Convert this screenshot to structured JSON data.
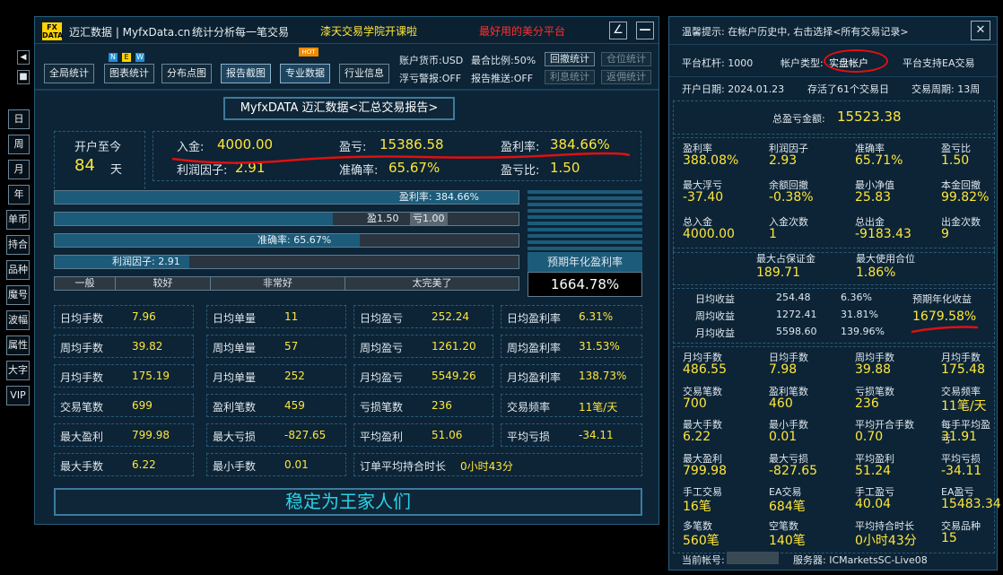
{
  "window": {
    "logo_top": "FX",
    "logo_bottom": "DATA",
    "title": "迈汇数据 | MyfxData.cn",
    "subtitle": "统计分析每一笔交易",
    "promo1": "漆天交易学院开课啦",
    "promo2": "最好用的美分平台",
    "pen_icon": "∠",
    "min_icon": "—"
  },
  "toolbar": {
    "buttons": [
      "全局统计",
      "图表统计",
      "分布点图",
      "报告截图",
      "专业数据",
      "行业信息"
    ],
    "new_badge": [
      "N",
      "E",
      "W"
    ],
    "hot_badge": "HOT",
    "currency": "账户货币:USD",
    "max_ratio": "最合比例:50%",
    "float_alert": "浮亏警报:OFF",
    "report_push": "报告推送:OFF",
    "small_buttons": [
      "回撤统计",
      "仓位统计",
      "利息统计",
      "返佣统计"
    ]
  },
  "left_nav": [
    "日",
    "周",
    "月",
    "年",
    "单币",
    "持合",
    "品种",
    "魔号",
    "波幅",
    "属性",
    "大字",
    "VIP"
  ],
  "report": {
    "title": "MyfxDATA 迈汇数据<汇总交易报告>",
    "since_label": "开户至今",
    "days": "84",
    "day_unit": "天",
    "deposit_label": "入金:",
    "deposit": "4000.00",
    "profit_label": "盈亏:",
    "profit": "15386.58",
    "return_label": "盈利率:",
    "return": "384.66%",
    "pf_label": "利润因子:",
    "pf": "2.91",
    "acc_label": "准确率:",
    "acc": "65.67%",
    "rr_label": "盈亏比:",
    "rr": "1.50"
  },
  "bars": {
    "return_text": "盈利率: 384.66%",
    "return_fraction": 1.0,
    "win_text": "盈1.50",
    "loss_text": "亏1.00",
    "win_fraction": 0.6,
    "acc_text": "准确率: 65.67%",
    "acc_fraction": 0.6567,
    "pf_text": "利润因子: 2.91",
    "pf_fraction": 0.29,
    "scale": [
      "一般",
      "较好",
      "非常好",
      "太完美了"
    ],
    "annual_label": "预期年化盈利率",
    "annual": "1664.78%"
  },
  "grid": [
    [
      [
        "日均手数",
        "7.96"
      ],
      [
        "日均单量",
        "11"
      ],
      [
        "日均盈亏",
        "252.24"
      ],
      [
        "日均盈利率",
        "6.31%"
      ]
    ],
    [
      [
        "周均手数",
        "39.82"
      ],
      [
        "周均单量",
        "57"
      ],
      [
        "周均盈亏",
        "1261.20"
      ],
      [
        "周均盈利率",
        "31.53%"
      ]
    ],
    [
      [
        "月均手数",
        "175.19"
      ],
      [
        "月均单量",
        "252"
      ],
      [
        "月均盈亏",
        "5549.26"
      ],
      [
        "月均盈利率",
        "138.73%"
      ]
    ],
    [
      [
        "交易笔数",
        "699"
      ],
      [
        "盈利笔数",
        "459"
      ],
      [
        "亏损笔数",
        "236"
      ],
      [
        "交易频率",
        "11笔/天"
      ]
    ],
    [
      [
        "最大盈利",
        "799.98"
      ],
      [
        "最大亏损",
        "-827.65"
      ],
      [
        "平均盈利",
        "51.06"
      ],
      [
        "平均亏损",
        "-34.11"
      ]
    ],
    [
      [
        "最大手数",
        "6.22"
      ],
      [
        "最小手数",
        "0.01"
      ],
      [
        "订单平均持合时长",
        "0小时43分"
      ]
    ]
  ],
  "slogan": "稳定为王家人们",
  "right": {
    "tip": "温馨提示: 在帐户历史中, 右击选择<所有交易记录>",
    "close_icon": "✕",
    "leverage": "平台杠杆: 1000",
    "acct_type_label": "帐户类型:",
    "acct_type": "实盘帐户",
    "ea_support": "平台支持EA交易",
    "open_date": "开户日期: 2024.01.23",
    "stored": "存活了61个交易日",
    "period": "交易周期: 13周",
    "total_label": "总盈亏金额:",
    "total": "15523.38",
    "blocks": [
      [
        [
          "盈利率",
          "388.08%"
        ],
        [
          "利润因子",
          "2.93"
        ],
        [
          "准确率",
          "65.71%"
        ],
        [
          "盈亏比",
          "1.50"
        ]
      ],
      [
        [
          "最大浮亏",
          "-37.40"
        ],
        [
          "余额回撤",
          "-0.38%"
        ],
        [
          "最小净值",
          "25.83"
        ],
        [
          "本金回撤",
          "99.82%"
        ]
      ],
      [
        [
          "总入金",
          "4000.00"
        ],
        [
          "入金次数",
          "1"
        ],
        [
          "总出金",
          "-9183.43"
        ],
        [
          "出金次数",
          "9"
        ]
      ]
    ],
    "margin": [
      [
        "最大占保证金",
        "189.71"
      ],
      [
        "最大使用合位",
        "1.86%"
      ]
    ],
    "avg": [
      [
        "日均收益",
        "254.48",
        "6.36%"
      ],
      [
        "周均收益",
        "1272.41",
        "31.81%"
      ],
      [
        "月均收益",
        "5598.60",
        "139.96%"
      ]
    ],
    "annual_label": "预期年化收益",
    "annual": "1679.58%",
    "blocks2": [
      [
        [
          "月均手数",
          "486.55"
        ],
        [
          "日均手数",
          "7.98"
        ],
        [
          "周均手数",
          "39.88"
        ],
        [
          "月均手数",
          "175.48"
        ]
      ],
      [
        [
          "交易笔数",
          "700"
        ],
        [
          "盈利笔数",
          "460"
        ],
        [
          "亏损笔数",
          "236"
        ],
        [
          "交易频率",
          "11笔/天"
        ]
      ],
      [
        [
          "最大手数",
          "6.22"
        ],
        [
          "最小手数",
          "0.01"
        ],
        [
          "平均开合手数",
          "0.70"
        ],
        [
          "每手平均盈亏",
          "31.91"
        ]
      ],
      [
        [
          "最大盈利",
          "799.98"
        ],
        [
          "最大亏损",
          "-827.65"
        ],
        [
          "平均盈利",
          "51.24"
        ],
        [
          "平均亏损",
          "-34.11"
        ]
      ],
      [
        [
          "手工交易",
          "16笔"
        ],
        [
          "EA交易",
          "684笔"
        ],
        [
          "手工盈亏",
          "40.04"
        ],
        [
          "EA盈亏",
          "15483.34"
        ]
      ],
      [
        [
          "多笔数",
          "560笔"
        ],
        [
          "空笔数",
          "140笔"
        ],
        [
          "平均持合时长",
          "0小时43分"
        ],
        [
          "交易品种",
          "15"
        ]
      ]
    ],
    "acct_label": "当前帐号:",
    "server": "服务器: ICMarketsSC-Live08"
  }
}
